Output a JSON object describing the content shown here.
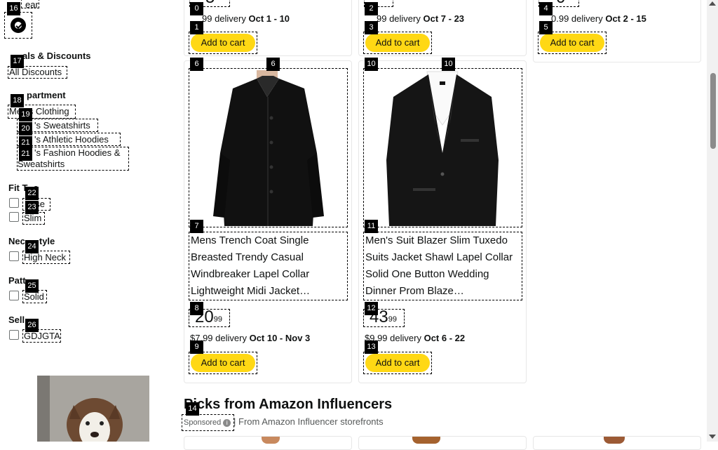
{
  "sidebar": {
    "top_partial_label": "ear",
    "deals_heading": "als & Discounts",
    "all_discounts": "All Discounts",
    "department_heading": "partment",
    "dept_mens_clothing": "Men's Clothing",
    "dept_sweatshirts": "'s Sweatshirts",
    "dept_athletic_hoodies": "'s Athletic Hoodies",
    "dept_fashion_hoodies_1": "'s Fashion Hoodies &",
    "dept_fashion_hoodies_2": "Sweatshirts",
    "fit_type_heading": "Fit T",
    "fit_type_heading_tail": "e",
    "fit_loose": "ose",
    "fit_slim": "Slim",
    "neck_heading": "Nec",
    "neck_heading_tail": "tyle",
    "neck_high": "High Neck",
    "pattern_heading": "Patt",
    "pattern_solid": "Solid",
    "seller_heading": "Sell",
    "seller_gdjgta": "GDJGTA"
  },
  "top_row": [
    {
      "price_partial": "5",
      "delivery_fee": "99 delivery",
      "delivery_dates": "Oct 1 - 10",
      "cart": "Add to cart"
    },
    {
      "price_partial": "",
      "delivery_fee": "99 delivery",
      "delivery_dates": "Oct 7 - 23",
      "cart": "Add to cart"
    },
    {
      "price_partial": "0",
      "delivery_fee": "0.99 delivery",
      "delivery_dates": "Oct 2 - 15",
      "cart": "Add to cart"
    }
  ],
  "products": [
    {
      "title": "Mens Trench Coat Single Breasted Trendy Casual Windbreaker Lapel Collar Lightweight Midi Jacket…",
      "price_whole": "20",
      "price_cents": "99",
      "delivery_fee": "$7.99 delivery",
      "delivery_dates": "Oct 10 - Nov 3",
      "cart": "Add to cart"
    },
    {
      "title": "Men's Suit Blazer Slim Tuxedo Suits Jacket Shawl Lapel Collar Solid One Button Wedding Dinner Prom Blaze…",
      "price_whole": "43",
      "price_cents": "99",
      "delivery_fee": "$9.99 delivery",
      "delivery_dates": "Oct 6 - 22",
      "cart": "Add to cart"
    }
  ],
  "influencers": {
    "heading": "Picks from Amazon Influencers",
    "sponsored": "Sponsored",
    "subtext": "From Amazon Influencer storefronts"
  },
  "badges": [
    "0",
    "1",
    "2",
    "3",
    "4",
    "5",
    "6",
    "6",
    "7",
    "8",
    "9",
    "10",
    "10",
    "11",
    "12",
    "13",
    "14",
    "16",
    "17",
    "18",
    "19",
    "20",
    "21",
    "21",
    "22",
    "23",
    "24",
    "25",
    "26"
  ],
  "colors": {
    "cart_button": "#ffd814",
    "link": "#0f1111"
  }
}
